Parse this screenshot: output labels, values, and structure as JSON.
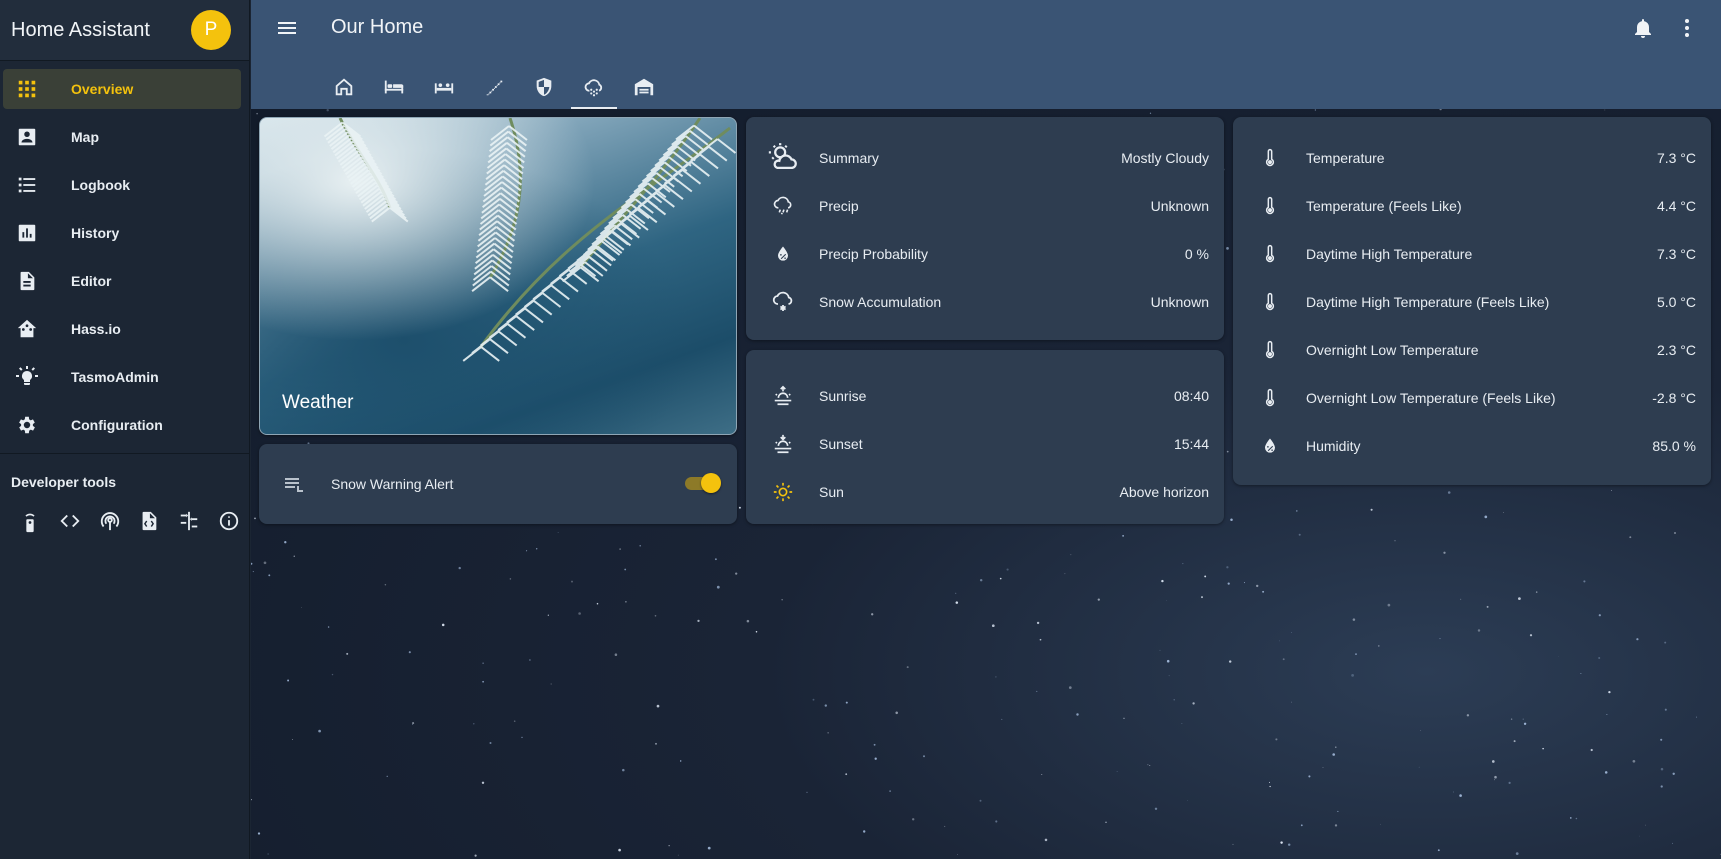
{
  "sidebar": {
    "title": "Home Assistant",
    "avatar_letter": "P",
    "items": [
      {
        "label": "Overview",
        "icon": "view-dashboard-icon",
        "active": true
      },
      {
        "label": "Map",
        "icon": "account-box-icon"
      },
      {
        "label": "Logbook",
        "icon": "format-list-bulleted-icon"
      },
      {
        "label": "History",
        "icon": "chart-box-icon"
      },
      {
        "label": "Editor",
        "icon": "file-document-icon"
      },
      {
        "label": "Hass.io",
        "icon": "home-assistant-icon"
      },
      {
        "label": "TasmoAdmin",
        "icon": "lightbulb-icon"
      },
      {
        "label": "Configuration",
        "icon": "gear-icon"
      }
    ],
    "developer_tools_title": "Developer tools",
    "developer_tools": [
      "remote-icon",
      "code-tags-icon",
      "radio-tower-icon",
      "file-xml-icon",
      "timeline-icon",
      "info-icon"
    ]
  },
  "header": {
    "title": "Our Home",
    "tabs": [
      "home-icon",
      "bed-icon",
      "sofa-bed-icon",
      "stairs-icon",
      "security-shield-icon",
      "weather-snowy-icon",
      "garage-icon"
    ],
    "active_tab": 5
  },
  "picture_card": {
    "name": "Weather"
  },
  "alert_card": {
    "label": "Snow Warning Alert",
    "state": "on"
  },
  "weather_card": {
    "rows": [
      {
        "name": "Summary",
        "value": "Mostly Cloudy",
        "icon": "weather-partly-cloudy-icon"
      },
      {
        "name": "Precip",
        "value": "Unknown",
        "icon": "weather-rainy-icon"
      },
      {
        "name": "Precip Probability",
        "value": "0 %",
        "icon": "water-percent-icon"
      },
      {
        "name": "Snow Accumulation",
        "value": "Unknown",
        "icon": "weather-snowy-icon"
      }
    ]
  },
  "sun_card": {
    "rows": [
      {
        "name": "Sunrise",
        "value": "08:40",
        "icon": "weather-sunset-up-icon"
      },
      {
        "name": "Sunset",
        "value": "15:44",
        "icon": "weather-sunset-down-icon"
      },
      {
        "name": "Sun",
        "value": "Above horizon",
        "icon": "sun-icon"
      }
    ]
  },
  "temp_card": {
    "rows": [
      {
        "name": "Temperature",
        "value": "7.3 °C",
        "icon": "thermometer-icon"
      },
      {
        "name": "Temperature (Feels Like)",
        "value": "4.4 °C",
        "icon": "thermometer-icon"
      },
      {
        "name": "Daytime High Temperature",
        "value": "7.3 °C",
        "icon": "thermometer-icon"
      },
      {
        "name": "Daytime High Temperature (Feels Like)",
        "value": "5.0 °C",
        "icon": "thermometer-icon"
      },
      {
        "name": "Overnight Low Temperature",
        "value": "2.3 °C",
        "icon": "thermometer-icon"
      },
      {
        "name": "Overnight Low Temperature (Feels Like)",
        "value": "-2.8 °C",
        "icon": "thermometer-icon"
      },
      {
        "name": "Humidity",
        "value": "85.0 %",
        "icon": "water-percent-icon"
      }
    ]
  },
  "colors": {
    "accent": "#f4c20d",
    "header": "#3a5474",
    "card": "#2e3d50",
    "sidebar": "#1c2634"
  }
}
